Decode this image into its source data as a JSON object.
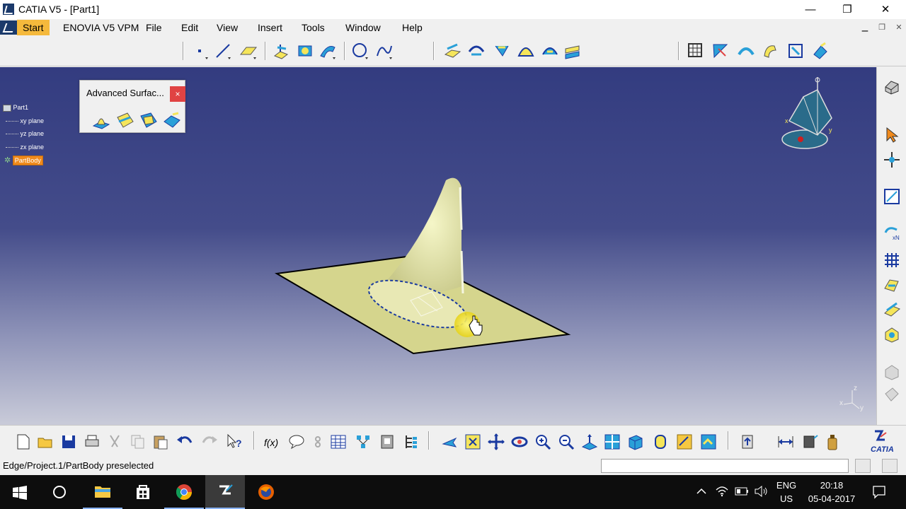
{
  "window": {
    "title": "CATIA V5 - [Part1]",
    "minimize": "—",
    "maximize": "❐",
    "close": "✕"
  },
  "menu": {
    "start": "Start",
    "items": [
      {
        "label": "ENOVIA V5 VPM"
      },
      {
        "label": "File"
      },
      {
        "label": "Edit"
      },
      {
        "label": "View"
      },
      {
        "label": "Insert"
      },
      {
        "label": "Tools"
      },
      {
        "label": "Window"
      },
      {
        "label": "Help"
      }
    ]
  },
  "toolbar_top": {
    "icons": [
      "point-icon",
      "line-icon",
      "plane-icon",
      "extrude-icon",
      "revolve-icon",
      "sweep-icon",
      "circle-icon",
      "spline-icon",
      "join-icon",
      "trim-icon",
      "fillet-icon",
      "blend-icon",
      "fill-icon",
      "offset-icon",
      "measure-grid-icon",
      "analysis-icon",
      "curvature-icon",
      "draft-icon",
      "boundary-icon",
      "transform-icon"
    ]
  },
  "tree": {
    "root": "Part1",
    "items": [
      "xy plane",
      "yz plane",
      "zx plane"
    ],
    "body": "PartBody",
    "body_color": "#f08a1c"
  },
  "advanced_panel": {
    "title": "Advanced Surfac...",
    "close": "×",
    "icons": [
      "bump-icon",
      "wrap-curve-icon",
      "wrap-surface-icon",
      "shape-morphing-icon"
    ]
  },
  "compass": {
    "x": "x",
    "y": "y",
    "z": "z"
  },
  "axis_triad": {
    "x": "x",
    "y": "y",
    "z": "z"
  },
  "right_toolbar": {
    "icons": [
      "view-rotate-icon",
      "select-arrow-icon",
      "snap-icon",
      "sketcher-icon",
      "repeat-icon",
      "grid-icon",
      "surface-icon",
      "extract-icon",
      "body-icon",
      "analysis-gray-icon",
      "analysis-gray-2-icon"
    ]
  },
  "toolbar_bottom": {
    "icons": [
      "new-icon",
      "open-icon",
      "save-icon",
      "print-icon",
      "cut-icon",
      "copy-icon",
      "paste-icon",
      "undo-icon",
      "redo-icon",
      "whats-this-icon",
      "formula-icon",
      "comment-icon",
      "link-icon",
      "table-icon",
      "knowledge-icon",
      "catalog-icon",
      "tree-icon",
      "fly-icon",
      "fit-all-icon",
      "pan-icon",
      "rotate-icon",
      "zoom-in-icon",
      "zoom-out-icon",
      "normal-view-icon",
      "multi-view-icon",
      "iso-view-icon",
      "shading-icon",
      "hide-show-icon",
      "swap-visible-icon",
      "update-icon",
      "measure-icon",
      "inertia-icon",
      "workbench-icon",
      "catia-logo-icon"
    ]
  },
  "status": {
    "message": "Edge/Project.1/PartBody preselected"
  },
  "taskbar": {
    "lang_line1": "ENG",
    "lang_line2": "US",
    "time": "20:18",
    "date": "05-04-2017"
  }
}
